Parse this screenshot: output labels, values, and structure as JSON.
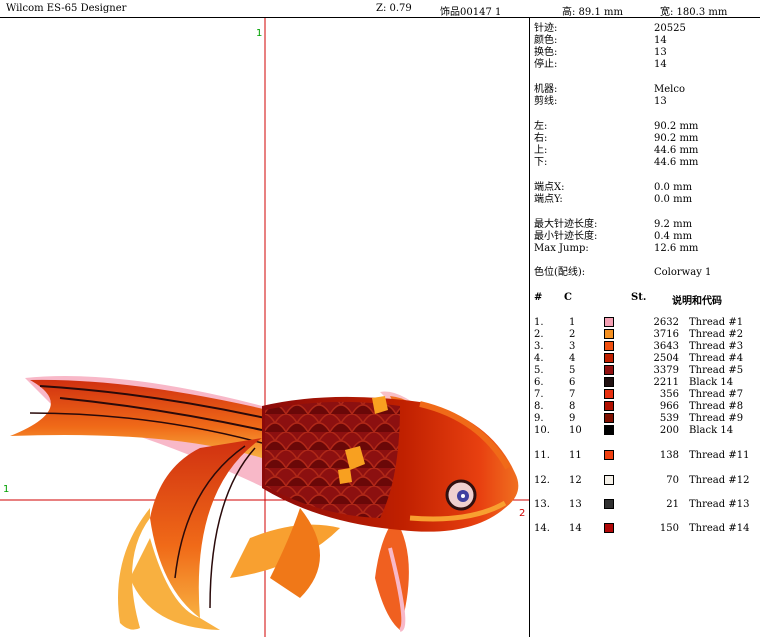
{
  "titlebar": {
    "app": "Wilcom ES-65 Designer",
    "zoom": "Z: 0.79",
    "design": "饰品00147 1",
    "height": "高: 89.1 mm",
    "width": "宽: 180.3 mm"
  },
  "canvas": {
    "label_top": "1",
    "label_left": "1",
    "label_right": "2"
  },
  "stats": [
    {
      "label": "针迹:",
      "value": "20525"
    },
    {
      "label": "颜色:",
      "value": "14"
    },
    {
      "label": "换色:",
      "value": "13"
    },
    {
      "label": "停止:",
      "value": "14"
    },
    {
      "label": "机器:",
      "value": "Melco"
    },
    {
      "label": "剪线:",
      "value": "13"
    },
    {
      "label": "左:",
      "value": "90.2 mm"
    },
    {
      "label": "右:",
      "value": "90.2 mm"
    },
    {
      "label": "上:",
      "value": "44.6 mm"
    },
    {
      "label": "下:",
      "value": "44.6 mm"
    },
    {
      "label": "端点X:",
      "value": "0.0 mm"
    },
    {
      "label": "端点Y:",
      "value": "0.0 mm"
    },
    {
      "label": "最大针迹长度:",
      "value": "9.2 mm"
    },
    {
      "label": "最小针迹长度:",
      "value": "0.4 mm"
    },
    {
      "label": "Max Jump:",
      "value": "12.6 mm"
    },
    {
      "label": "色位(配线):",
      "value": "Colorway 1"
    }
  ],
  "table": {
    "headers": {
      "num": "#",
      "c": "C",
      "st": "St.",
      "desc": "说明和代码"
    },
    "rows": [
      {
        "num": "1.",
        "c": "1",
        "color": "#f4a0b4",
        "st": "2632",
        "desc": "Thread #1"
      },
      {
        "num": "2.",
        "c": "2",
        "color": "#f59020",
        "st": "3716",
        "desc": "Thread #2"
      },
      {
        "num": "3.",
        "c": "3",
        "color": "#f05010",
        "st": "3643",
        "desc": "Thread #3"
      },
      {
        "num": "4.",
        "c": "4",
        "color": "#c02000",
        "st": "2504",
        "desc": "Thread #4"
      },
      {
        "num": "5.",
        "c": "5",
        "color": "#901010",
        "st": "3379",
        "desc": "Thread #5"
      },
      {
        "num": "6.",
        "c": "6",
        "color": "#201010",
        "st": "2211",
        "desc": "Black 14"
      },
      {
        "num": "7.",
        "c": "7",
        "color": "#e83010",
        "st": "356",
        "desc": "Thread #7"
      },
      {
        "num": "8.",
        "c": "8",
        "color": "#b01000",
        "st": "966",
        "desc": "Thread #8"
      },
      {
        "num": "9.",
        "c": "9",
        "color": "#801000",
        "st": "539",
        "desc": "Thread #9"
      },
      {
        "num": "10.",
        "c": "10",
        "color": "#000000",
        "st": "200",
        "desc": "Black 14"
      },
      {
        "num": "11.",
        "c": "11",
        "color": "#f04010",
        "st": "138",
        "desc": "Thread #11"
      },
      {
        "num": "12.",
        "c": "12",
        "color": "#f4f0e8",
        "st": "70",
        "desc": "Thread #12"
      },
      {
        "num": "13.",
        "c": "13",
        "color": "#303030",
        "st": "21",
        "desc": "Thread #13"
      },
      {
        "num": "14.",
        "c": "14",
        "color": "#b00808",
        "st": "150",
        "desc": "Thread #14"
      }
    ]
  }
}
